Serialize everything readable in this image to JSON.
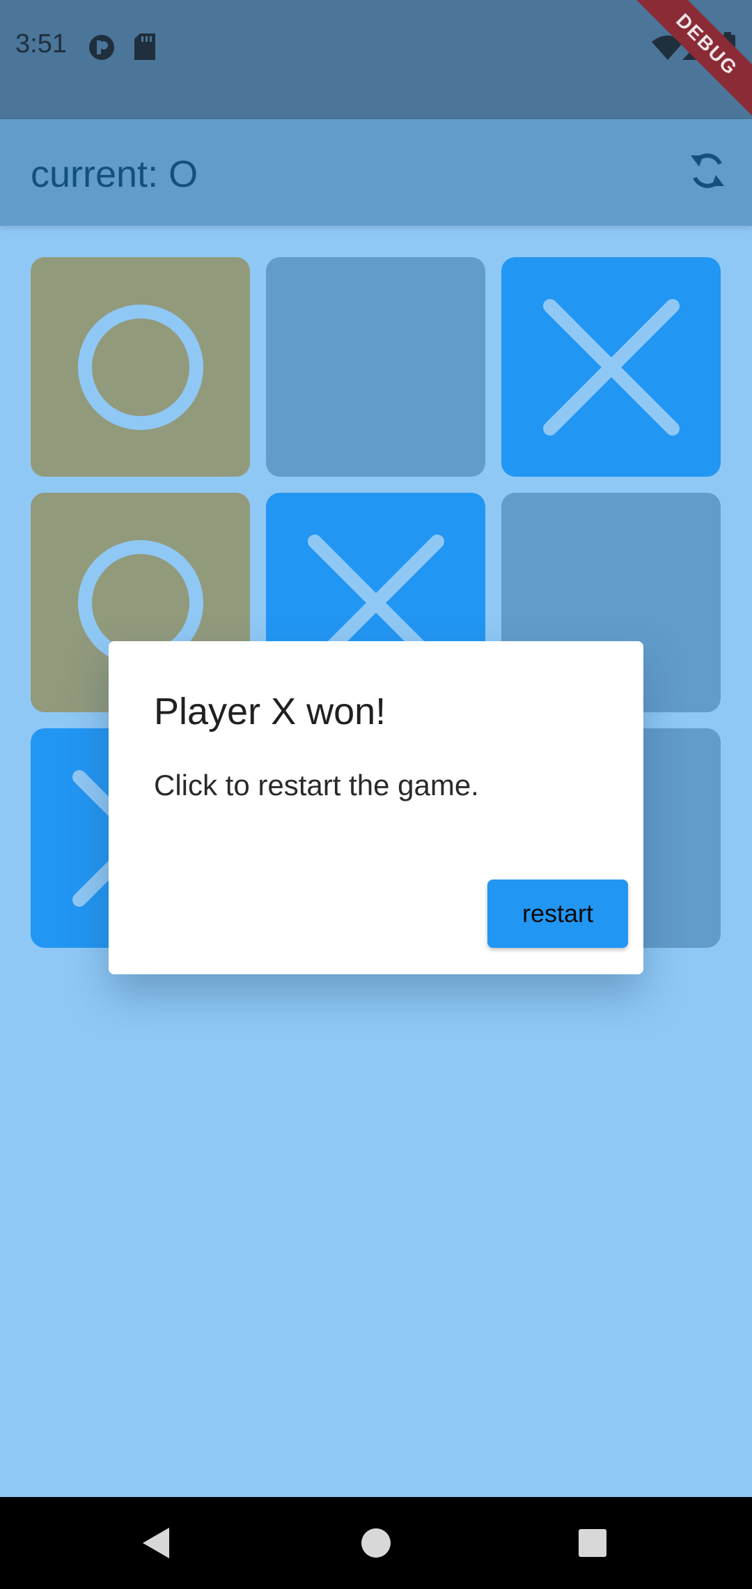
{
  "status_bar": {
    "time": "3:51",
    "icons": [
      "app-indicator-icon",
      "sd-card-icon",
      "wifi-icon",
      "signal-icon",
      "battery-icon"
    ]
  },
  "debug_banner": "DEBUG",
  "app_bar": {
    "title": "current: O",
    "action_icon": "refresh-icon"
  },
  "board": {
    "cells": [
      "O",
      "",
      "X",
      "O",
      "X",
      "",
      "X",
      "",
      ""
    ],
    "winning_cells": [
      0,
      3
    ],
    "colors": {
      "winning": "#929a7c",
      "empty": "#629ccb",
      "x": "#2296f3",
      "mark": "#90c8f5"
    }
  },
  "dialog": {
    "title": "Player X won!",
    "message": "Click to restart the game.",
    "restart_label": "restart"
  },
  "nav_bar": {
    "icons": [
      "back-icon",
      "home-icon",
      "recents-icon"
    ]
  }
}
